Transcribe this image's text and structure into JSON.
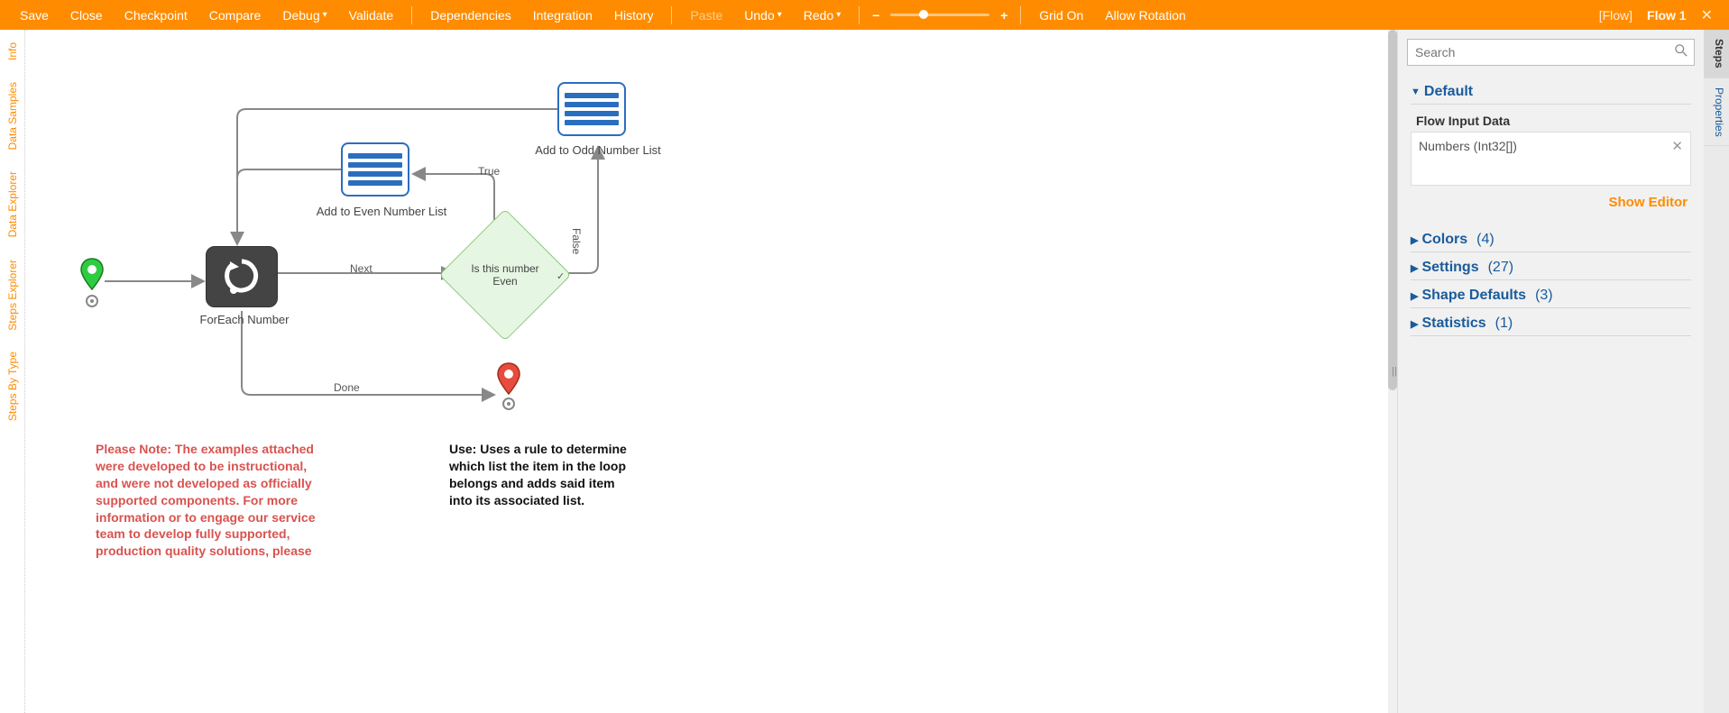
{
  "toolbar": {
    "save": "Save",
    "close": "Close",
    "checkpoint": "Checkpoint",
    "compare": "Compare",
    "debug": "Debug",
    "validate": "Validate",
    "dependencies": "Dependencies",
    "integration": "Integration",
    "history": "History",
    "paste": "Paste",
    "undo": "Undo",
    "redo": "Redo",
    "grid_on": "Grid On",
    "allow_rotation": "Allow Rotation",
    "flow_type": "[Flow]",
    "flow_name": "Flow 1"
  },
  "left_tabs": {
    "info": "Info",
    "data_samples": "Data Samples",
    "data_explorer": "Data Explorer",
    "steps_explorer": "Steps Explorer",
    "steps_by_type": "Steps By Type"
  },
  "canvas": {
    "foreach_label": "ForEach Number",
    "even_list_label": "Add to Even Number List",
    "odd_list_label": "Add to Odd Number List",
    "decision_text": "Is this number Even",
    "edge_next": "Next",
    "edge_done": "Done",
    "edge_true": "True",
    "edge_false": "False",
    "note_red": "Please Note: The examples attached were developed to be instructional, and were not developed as officially supported components.  For more information or to engage our service team to develop fully supported, production quality solutions, please",
    "note_black": "Use: Uses a rule to determine which list the item in the loop belongs and adds said item into its associated list."
  },
  "right": {
    "search_placeholder": "Search",
    "sections": {
      "default": "Default",
      "colors": "Colors",
      "colors_count": "(4)",
      "settings": "Settings",
      "settings_count": "(27)",
      "shape_defaults": "Shape Defaults",
      "shape_defaults_count": "(3)",
      "statistics": "Statistics",
      "statistics_count": "(1)"
    },
    "flow_input_title": "Flow Input Data",
    "flow_input_item": "Numbers (Int32[])",
    "show_editor": "Show Editor",
    "tabs": {
      "steps": "Steps",
      "properties": "Properties"
    }
  }
}
